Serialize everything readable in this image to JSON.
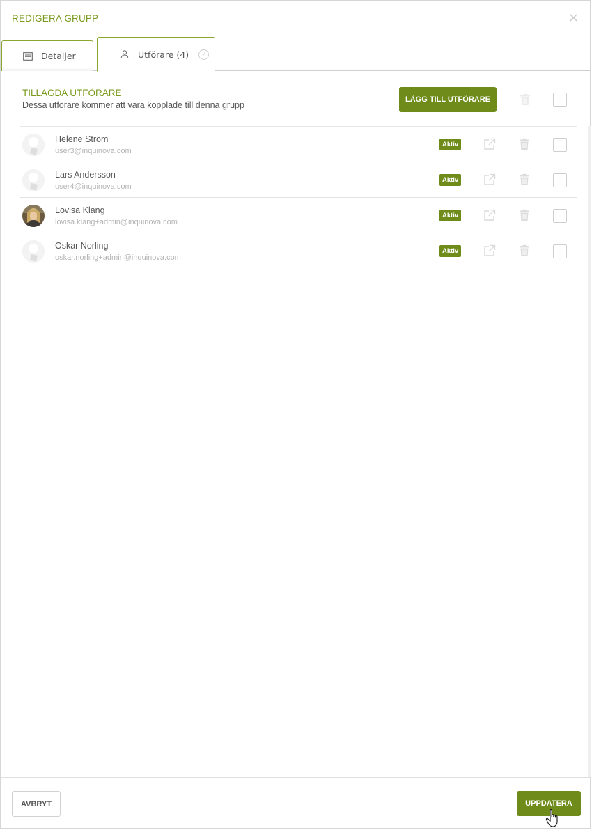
{
  "dialog": {
    "title": "REDIGERA GRUPP",
    "close_symbol": "×"
  },
  "tabs": [
    {
      "label": "Detaljer",
      "icon": "details-list-icon",
      "active": false
    },
    {
      "label": "Utförare (4)",
      "icon": "person-icon",
      "active": true,
      "help_icon": "question-circle-icon",
      "help_symbol": "?"
    }
  ],
  "section": {
    "title": "TILLAGDA UTFÖRARE",
    "subtitle": "Dessa utförare kommer att vara kopplade till denna grupp",
    "add_button": "LÄGG TILL UTFÖRARE"
  },
  "performers": [
    {
      "name": "Helene Ström",
      "email": "user3@inquinova.com",
      "status": "Aktiv",
      "avatar": "placeholder"
    },
    {
      "name": "Lars Andersson",
      "email": "user4@inquinova.com",
      "status": "Aktiv",
      "avatar": "placeholder"
    },
    {
      "name": "Lovisa Klang",
      "email": "lovisa.klang+admin@inquinova.com",
      "status": "Aktiv",
      "avatar": "photo"
    },
    {
      "name": "Oskar Norling",
      "email": "oskar.norling+admin@inquinova.com",
      "status": "Aktiv",
      "avatar": "placeholder"
    }
  ],
  "footer": {
    "cancel_button": "AVBRYT",
    "update_button": "UPPDATERA"
  },
  "colors": {
    "accent": "#6f8c1a",
    "title_green": "#7a9a1e",
    "muted_icon": "#d9d9d9"
  }
}
